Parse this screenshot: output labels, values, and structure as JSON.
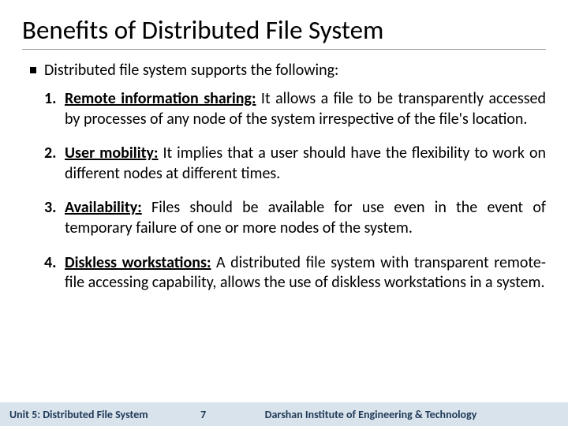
{
  "title": "Benefits of Distributed File System",
  "intro": "Distributed file system supports the following:",
  "items": [
    {
      "num": "1.",
      "term": "Remote information sharing:",
      "desc": " It allows a file to be transparently accessed by processes of any node of the system irrespective of the file's location."
    },
    {
      "num": "2.",
      "term": "User mobility:",
      "desc": " It implies that a user should have the flexibility to work on different nodes at different times."
    },
    {
      "num": "3.",
      "term": "Availability:",
      "desc": " Files should be available for use even in the event of temporary failure of one or more nodes of the system."
    },
    {
      "num": "4.",
      "term": "Diskless workstations:",
      "desc": " A distributed file system with transparent remote-file accessing capability, allows the use of diskless workstations in a system."
    }
  ],
  "footer": {
    "left": "Unit 5: Distributed File System",
    "page": "7",
    "right": "Darshan Institute of Engineering & Technology"
  }
}
